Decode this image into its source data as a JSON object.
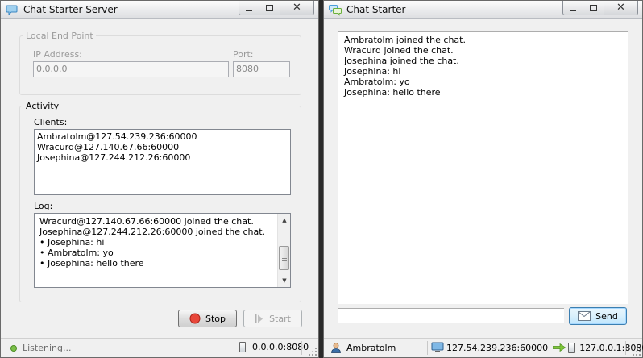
{
  "server": {
    "title": "Chat Starter Server",
    "local_end_point": {
      "legend": "Local End Point",
      "ip_label": "IP Address:",
      "ip_value": "0.0.0.0",
      "port_label": "Port:",
      "port_value": "8080"
    },
    "activity": {
      "legend": "Activity",
      "clients_label": "Clients:",
      "clients": [
        "Ambratolm@127.54.239.236:60000",
        "Wracurd@127.140.67.66:60000",
        "Josephina@127.244.212.26:60000"
      ],
      "log_label": "Log:",
      "log": [
        "Wracurd@127.140.67.66:60000 joined the chat.",
        "Josephina@127.244.212.26:60000 joined the chat.",
        "• Josephina: hi",
        "• Ambratolm: yo",
        "• Josephina: hello there"
      ]
    },
    "buttons": {
      "stop": "Stop",
      "start": "Start"
    },
    "status": {
      "state": "Listening...",
      "endpoint": "0.0.0.0:8080"
    },
    "colors": {
      "stop_icon": "#e8473a",
      "status_dot": "#7cc04a"
    }
  },
  "client": {
    "title": "Chat Starter",
    "messages": [
      "Ambratolm joined the chat.",
      "Wracurd joined the chat.",
      "Josephina joined the chat.",
      "Josephina: hi",
      "Ambratolm: yo",
      "Josephina: hello there"
    ],
    "input_value": "",
    "send_label": "Send",
    "status": {
      "username": "Ambratolm",
      "local_endpoint": "127.54.239.236:60000",
      "remote_endpoint": "127.0.0.1:8080"
    },
    "colors": {
      "arrow": "#7ec63a",
      "title_icon": "#4a9fd8"
    }
  }
}
